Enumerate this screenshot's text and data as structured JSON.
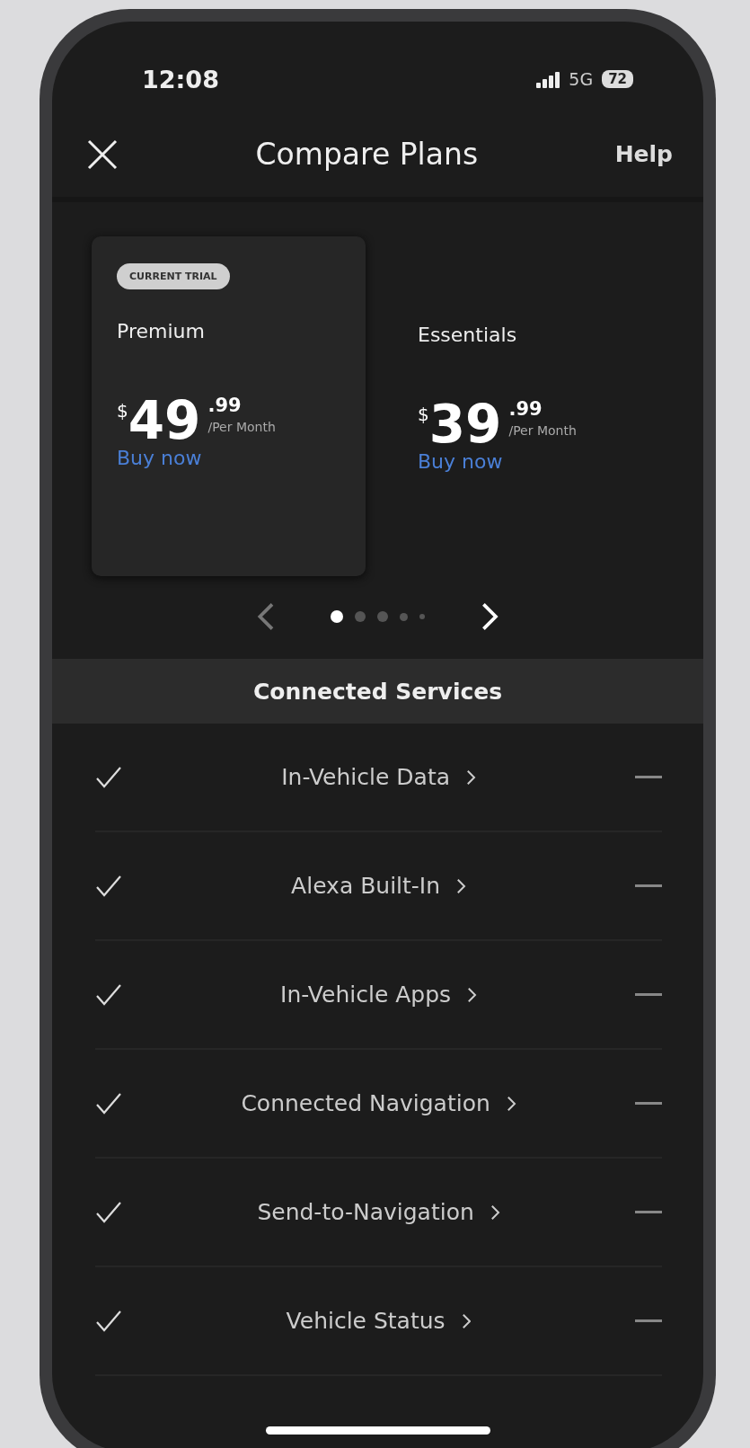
{
  "status_bar": {
    "time": "12:08",
    "network": "5G",
    "battery": "72"
  },
  "header": {
    "title": "Compare Plans",
    "help": "Help"
  },
  "plans": [
    {
      "badge": "CURRENT TRIAL",
      "name": "Premium",
      "currency": "$",
      "price_whole": "49",
      "price_cents": ".99",
      "period": "/Per Month",
      "action": "Buy now",
      "selected": true
    },
    {
      "name": "Essentials",
      "currency": "$",
      "price_whole": "39",
      "price_cents": ".99",
      "period": "/Per Month",
      "action": "Buy now",
      "selected": false
    }
  ],
  "pager": {
    "pages": [
      {
        "selected": true
      },
      {
        "selected": false
      },
      {
        "selected": false
      },
      {
        "selected": false
      },
      {
        "selected": false
      }
    ]
  },
  "section": {
    "title": "Connected Services"
  },
  "features": [
    {
      "name": "In-Vehicle Data",
      "premium": true,
      "essentials": false
    },
    {
      "name": "Alexa Built-In",
      "premium": true,
      "essentials": false
    },
    {
      "name": "In-Vehicle Apps",
      "premium": true,
      "essentials": false
    },
    {
      "name": "Connected Navigation",
      "premium": true,
      "essentials": false
    },
    {
      "name": "Send-to-Navigation",
      "premium": true,
      "essentials": false
    },
    {
      "name": "Vehicle Status",
      "premium": true,
      "essentials": false
    }
  ]
}
